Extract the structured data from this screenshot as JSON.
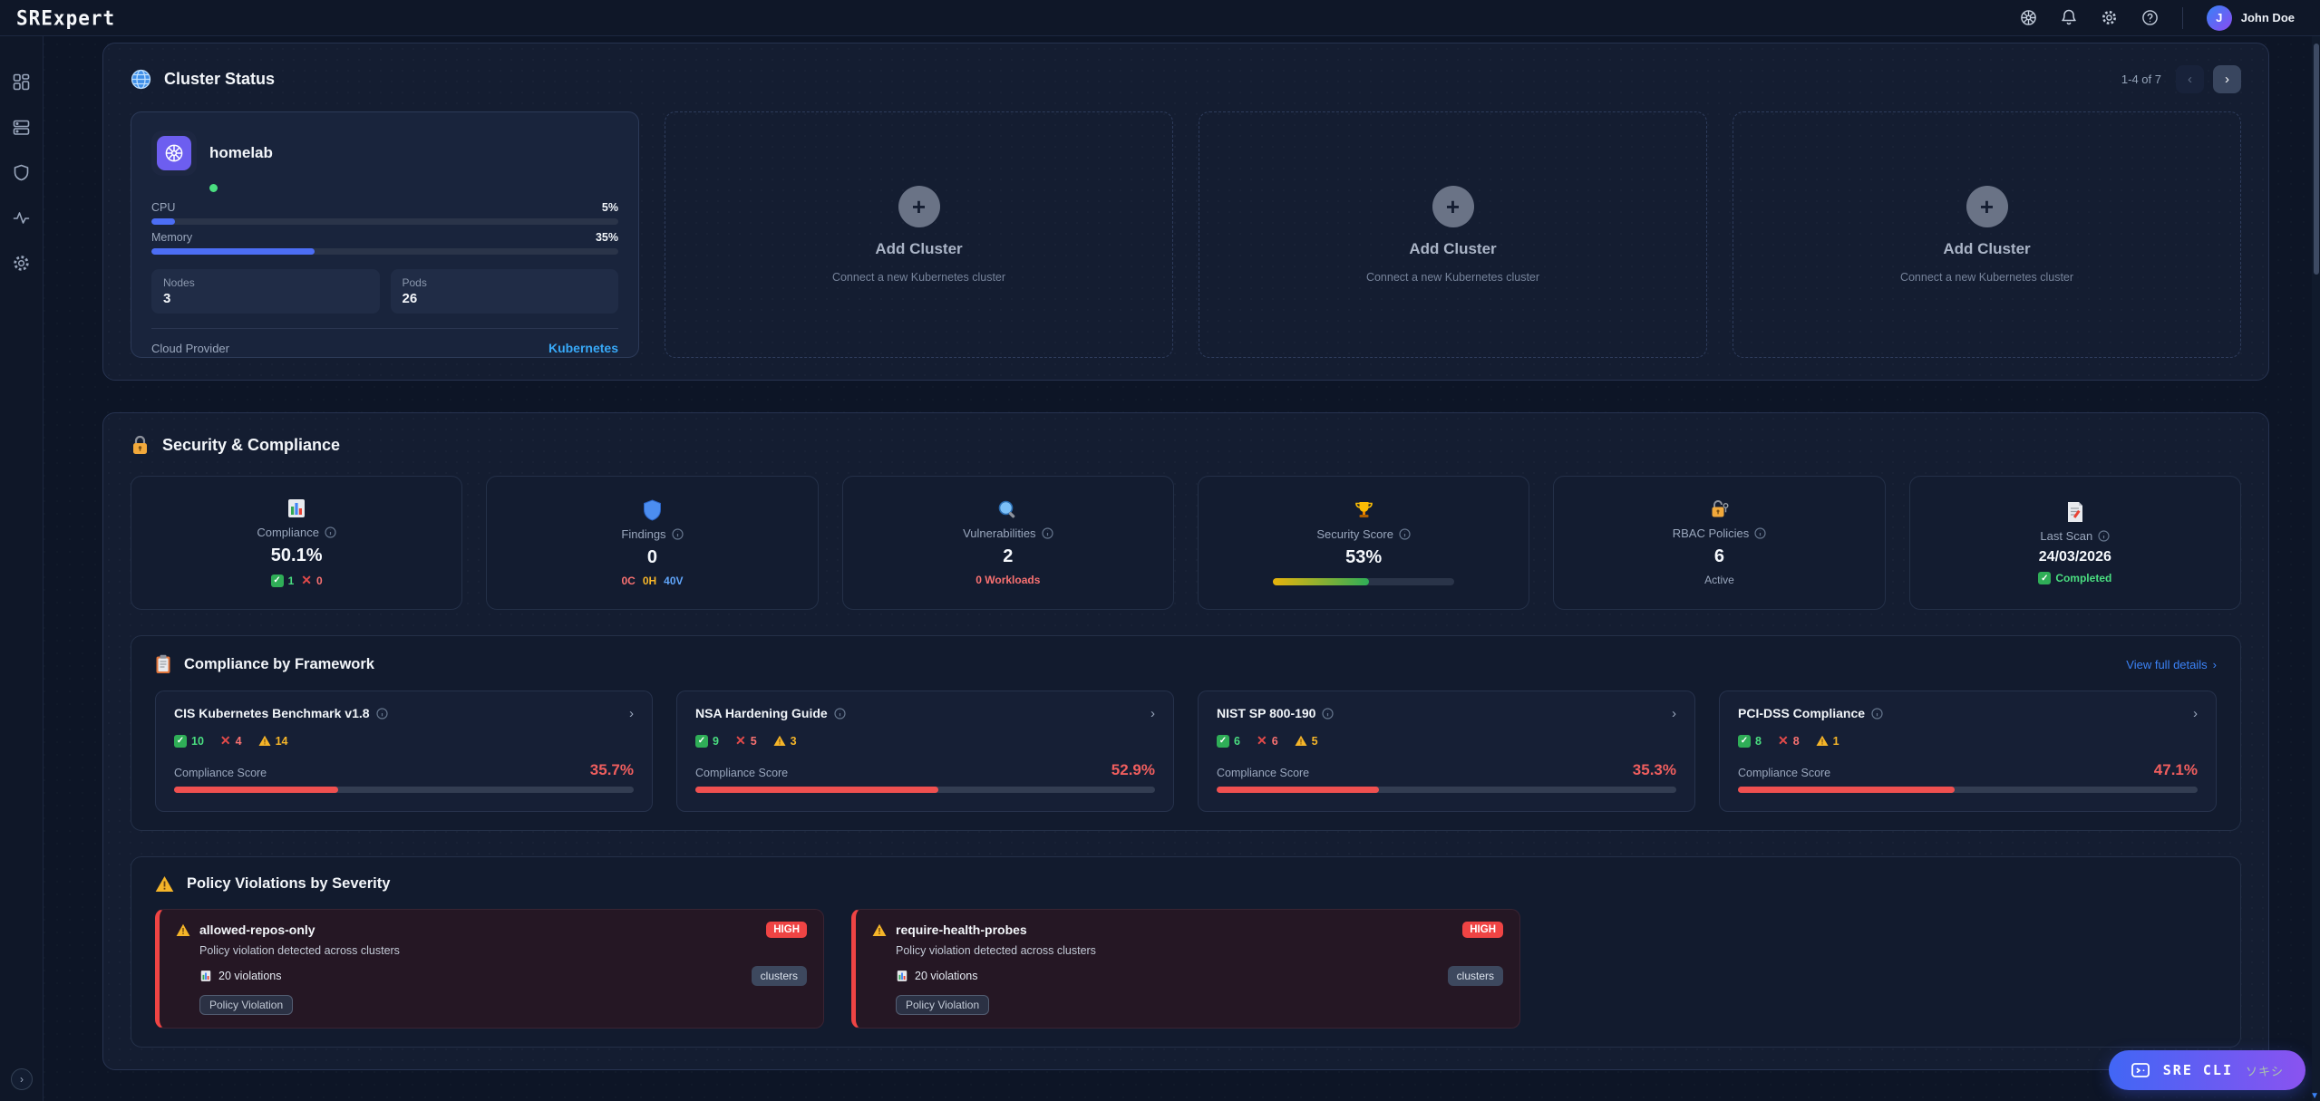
{
  "colors": {
    "accent": "#3b82f6",
    "danger": "#ef4444",
    "warning": "#f5b529",
    "success": "#22c55e",
    "link": "#38a9f8",
    "progress_blue": "#4c6ef5"
  },
  "topbar": {
    "logo": "SRExpert",
    "user_initial": "J",
    "user_name": "John Doe"
  },
  "cluster_status": {
    "title": "Cluster Status",
    "pagination": "1-4 of 7",
    "cluster": {
      "name": "homelab",
      "cpu_label": "CPU",
      "cpu_value": "5%",
      "cpu_pct": 5,
      "memory_label": "Memory",
      "memory_value": "35%",
      "memory_pct": 35,
      "nodes_label": "Nodes",
      "nodes_value": "3",
      "pods_label": "Pods",
      "pods_value": "26",
      "provider_label": "Cloud Provider",
      "provider_value": "Kubernetes"
    },
    "add_cluster_label": "Add Cluster",
    "add_cluster_sublabel": "Connect a new Kubernetes cluster"
  },
  "security": {
    "title": "Security & Compliance",
    "stats": [
      {
        "label": "Compliance",
        "value": "50.1%",
        "pass": "1",
        "fail": "0"
      },
      {
        "label": "Findings",
        "value": "0",
        "critical": "0C",
        "high": "0H",
        "vuln": "40V"
      },
      {
        "label": "Vulnerabilities",
        "value": "2",
        "sub": "0 Workloads"
      },
      {
        "label": "Security Score",
        "value": "53%",
        "score_pct": 53
      },
      {
        "label": "RBAC Policies",
        "value": "6",
        "sub": "Active"
      },
      {
        "label": "Last Scan",
        "value": "24/03/2026",
        "sub": "Completed"
      }
    ],
    "frameworks_title": "Compliance by Framework",
    "frameworks_link": "View full details",
    "score_label": "Compliance Score",
    "frameworks": [
      {
        "name": "CIS Kubernetes Benchmark v1.8",
        "pass": "10",
        "fail": "4",
        "warn": "14",
        "score": "35.7%",
        "score_pct": 35.7
      },
      {
        "name": "NSA Hardening Guide",
        "pass": "9",
        "fail": "5",
        "warn": "3",
        "score": "52.9%",
        "score_pct": 52.9
      },
      {
        "name": "NIST SP 800-190",
        "pass": "6",
        "fail": "6",
        "warn": "5",
        "score": "35.3%",
        "score_pct": 35.3
      },
      {
        "name": "PCI-DSS Compliance",
        "pass": "8",
        "fail": "8",
        "warn": "1",
        "score": "47.1%",
        "score_pct": 47.1
      }
    ],
    "violations_title": "Policy Violations by Severity",
    "violations": [
      {
        "name": "allowed-repos-only",
        "severity": "HIGH",
        "description": "Policy violation detected across clusters",
        "count": "20 violations",
        "tag": "clusters",
        "badge": "Policy Violation"
      },
      {
        "name": "require-health-probes",
        "severity": "HIGH",
        "description": "Policy violation detected across clusters",
        "count": "20 violations",
        "tag": "clusters",
        "badge": "Policy Violation"
      }
    ]
  },
  "cli_button": {
    "label": "SRE CLI",
    "suffix": "ソキシ"
  }
}
